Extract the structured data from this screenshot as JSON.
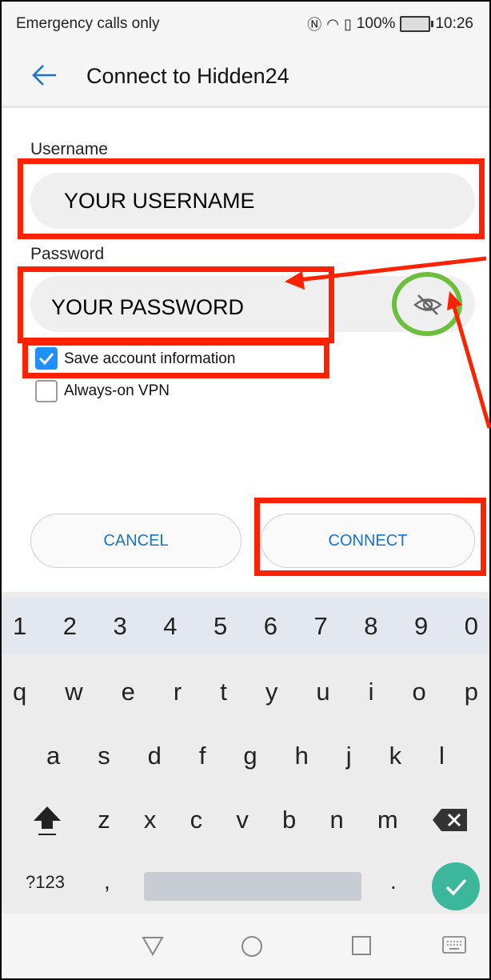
{
  "status_bar": {
    "left_text": "Emergency calls only",
    "battery_text": "100%",
    "time": "10:26"
  },
  "header": {
    "title": "Connect to Hidden24",
    "back_icon": "back-arrow-icon"
  },
  "form": {
    "username_label": "Username",
    "username_value": "YOUR USERNAME",
    "password_label": "Password",
    "password_value": "YOUR PASSWORD",
    "visibility_icon": "eye-off-icon",
    "save_account_label": "Save account information",
    "save_account_checked": true,
    "always_on_vpn_label": "Always-on VPN",
    "always_on_vpn_checked": false
  },
  "actions": {
    "cancel_label": "CANCEL",
    "connect_label": "CONNECT"
  },
  "keyboard": {
    "number_row": [
      "1",
      "2",
      "3",
      "4",
      "5",
      "6",
      "7",
      "8",
      "9",
      "0"
    ],
    "row1": [
      "q",
      "w",
      "e",
      "r",
      "t",
      "y",
      "u",
      "i",
      "o",
      "p"
    ],
    "row2": [
      "a",
      "s",
      "d",
      "f",
      "g",
      "h",
      "j",
      "k",
      "l"
    ],
    "row3": [
      "z",
      "x",
      "c",
      "v",
      "b",
      "n",
      "m"
    ],
    "symbols_label": "?123",
    "comma": ",",
    "period": "."
  },
  "colors": {
    "accent": "#1a73c7",
    "annotation_red": "#ff2200",
    "annotation_green": "#6bbf3a",
    "checkbox_on": "#1e90ff",
    "done_key": "#3bb89c"
  }
}
